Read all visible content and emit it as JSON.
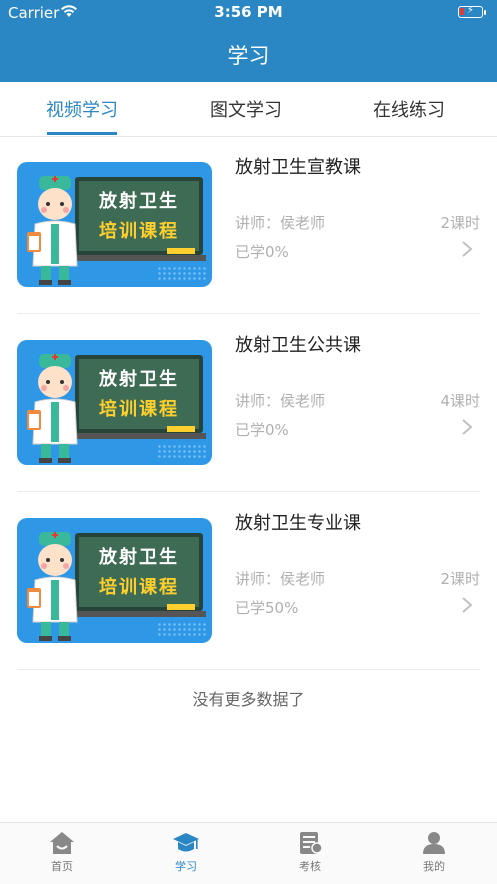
{
  "status_bar": {
    "carrier": "Carrier",
    "time": "3:56 PM"
  },
  "header": {
    "title": "学习"
  },
  "tabs": [
    {
      "label": "视频学习",
      "active": true
    },
    {
      "label": "图文学习",
      "active": false
    },
    {
      "label": "在线练习",
      "active": false
    }
  ],
  "thumbnail": {
    "line1": "放射卫生",
    "line2": "培训课程"
  },
  "courses": [
    {
      "title": "放射卫生宣教课",
      "teacher": "讲师：侯老师",
      "hours": "2课时",
      "progress": "已学0%"
    },
    {
      "title": "放射卫生公共课",
      "teacher": "讲师：侯老师",
      "hours": "4课时",
      "progress": "已学0%"
    },
    {
      "title": "放射卫生专业课",
      "teacher": "讲师：侯老师",
      "hours": "2课时",
      "progress": "已学50%"
    }
  ],
  "footer_text": "没有更多数据了",
  "bottom_nav": [
    {
      "label": "首页",
      "icon": "home-icon",
      "active": false
    },
    {
      "label": "学习",
      "icon": "graduation-cap-icon",
      "active": true
    },
    {
      "label": "考核",
      "icon": "exam-icon",
      "active": false
    },
    {
      "label": "我的",
      "icon": "user-icon",
      "active": false
    }
  ],
  "colors": {
    "primary": "#2b86c4",
    "muted_text": "#b0b0b0",
    "thumb_bg": "#2e98e6",
    "chalkboard": "#3d6b53",
    "chalk_yellow": "#ffcf2e"
  }
}
